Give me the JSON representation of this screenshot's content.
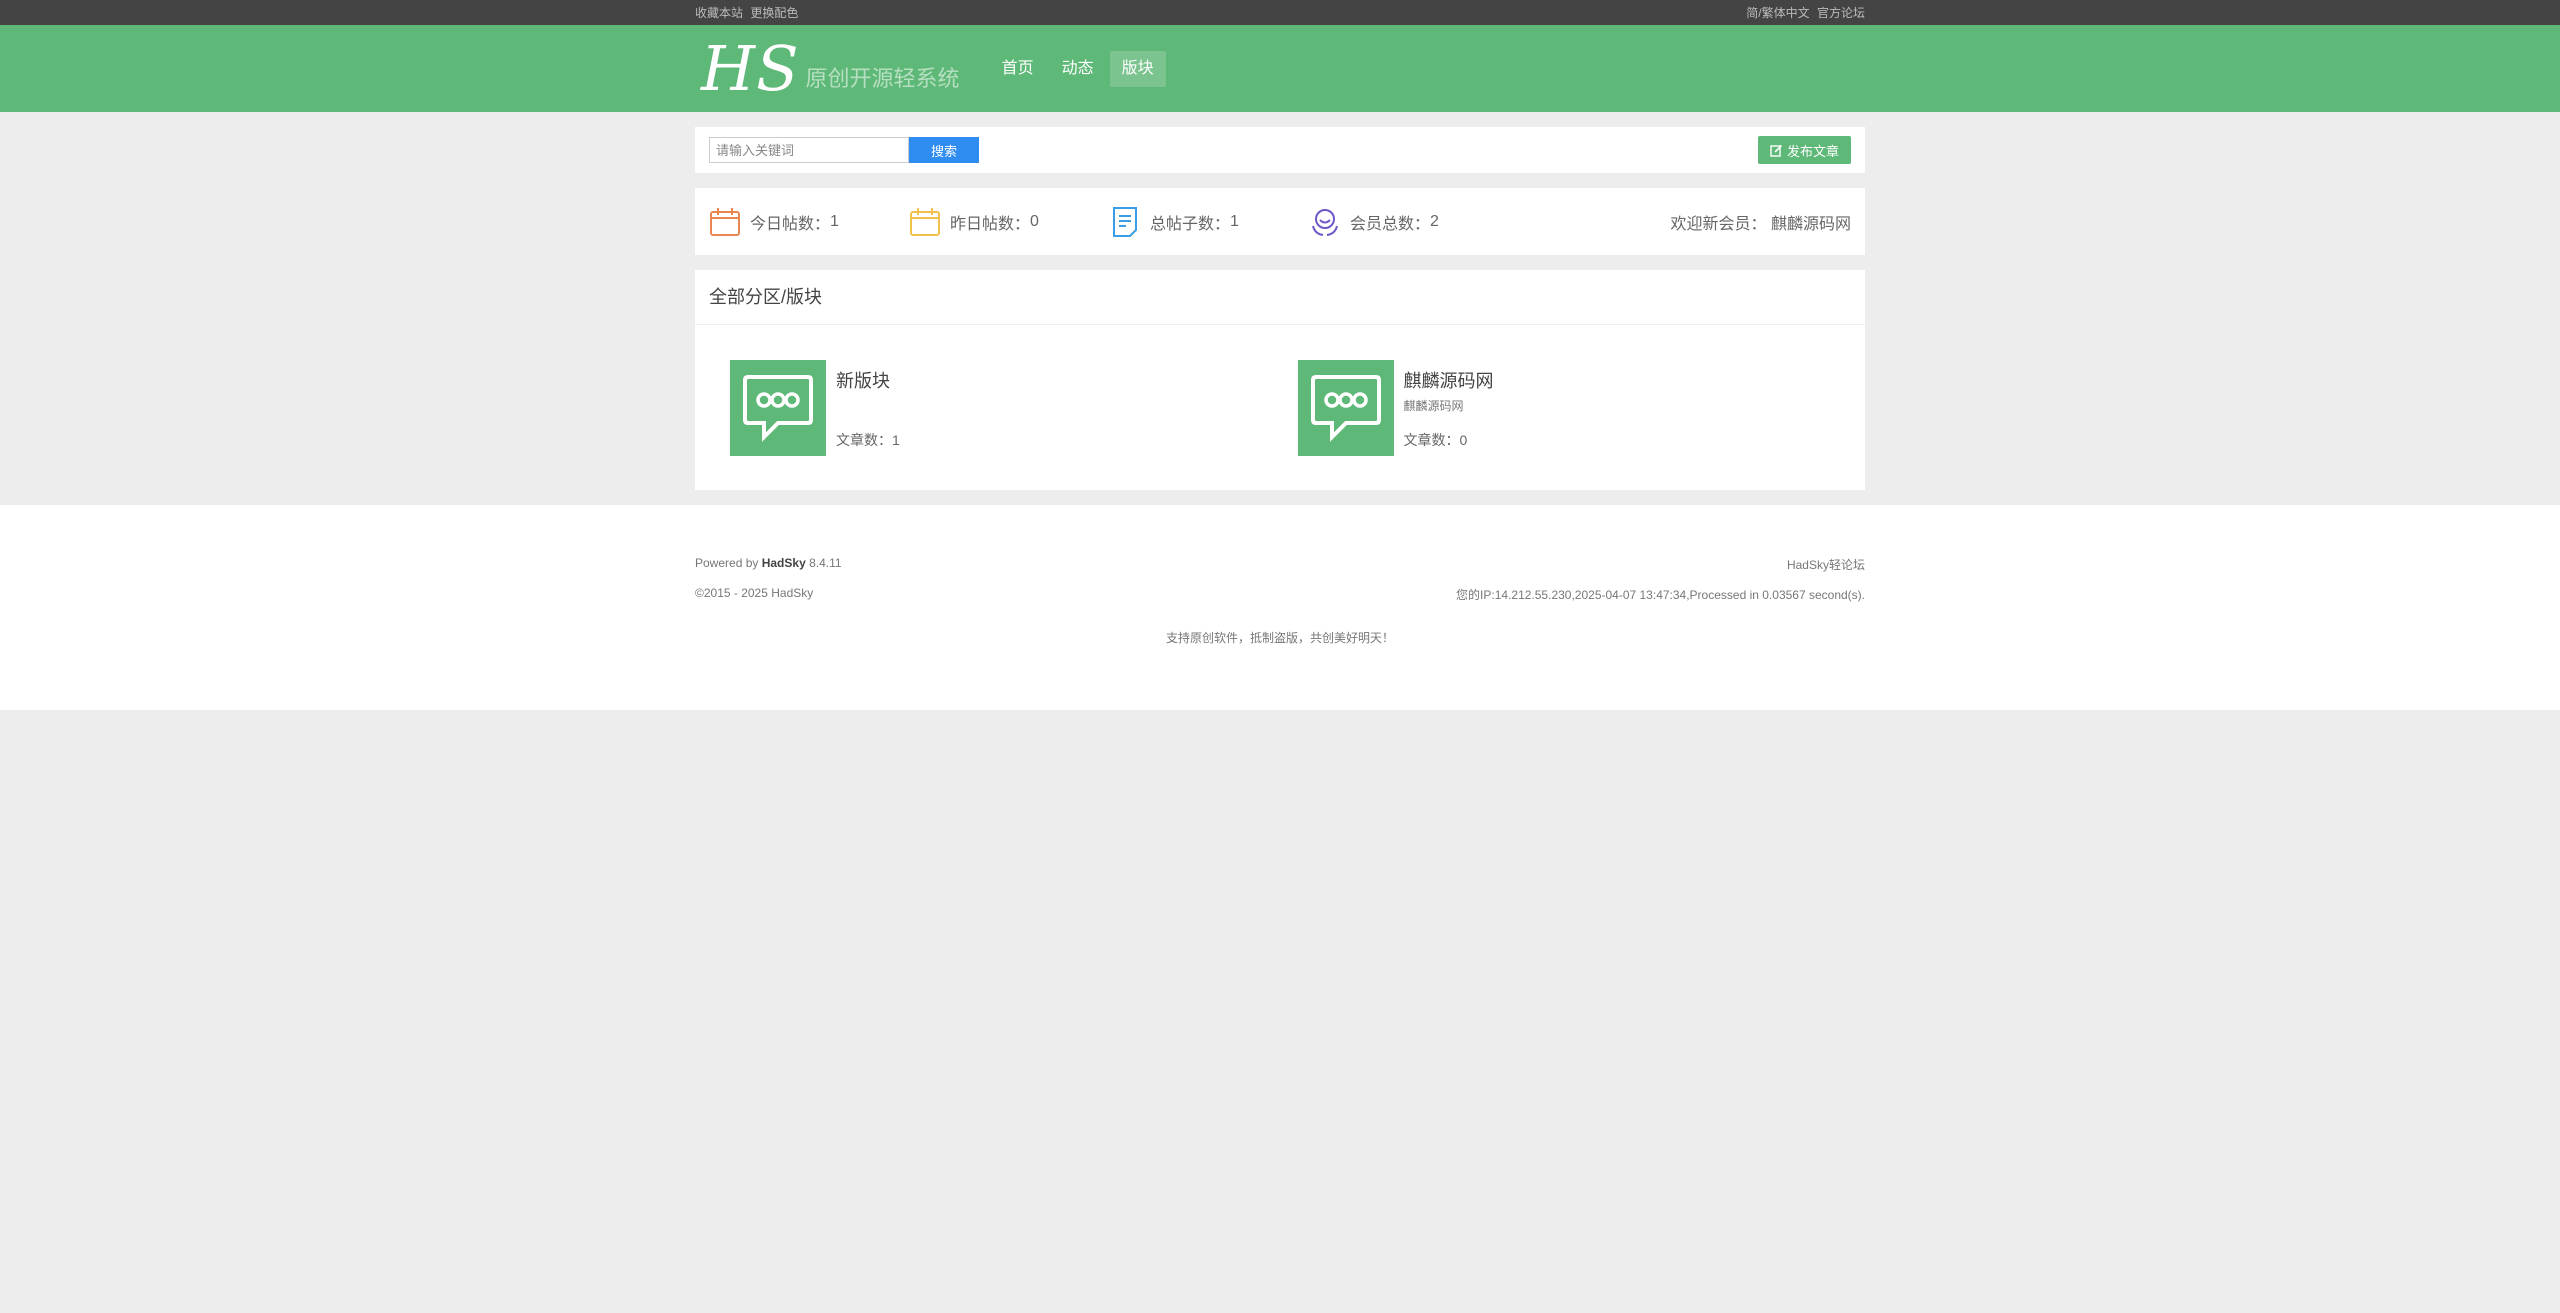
{
  "topbar": {
    "left": [
      "收藏本站",
      "更换配色"
    ],
    "right": [
      "简/繁体中文",
      "官方论坛"
    ]
  },
  "header": {
    "logo_main": "HS",
    "logo_sub": "原创开源轻系统",
    "nav": [
      {
        "label": "首页",
        "active": false
      },
      {
        "label": "动态",
        "active": false
      },
      {
        "label": "版块",
        "active": true
      }
    ]
  },
  "search": {
    "placeholder": "请输入关键词",
    "button": "搜索",
    "post_button": "发布文章"
  },
  "stats": {
    "today_label": "今日帖数：",
    "today": "1",
    "yesterday_label": "昨日帖数：",
    "yesterday": "0",
    "total_label": "总帖子数：",
    "total": "1",
    "members_label": "会员总数：",
    "members": "2",
    "welcome_label": "欢迎新会员：",
    "welcome_user": "麒麟源码网"
  },
  "colors": {
    "today_icon": "#e8874f",
    "yesterday_icon": "#f0c14b",
    "total_icon": "#3a9ee6",
    "members_icon": "#6f56c9",
    "green": "#5eb877"
  },
  "boards": {
    "title": "全部分区/版块",
    "items": [
      {
        "name": "新版块",
        "desc": "",
        "count_label": "文章数：",
        "count": "1"
      },
      {
        "name": "麒麟源码网",
        "desc": "麒麟源码网",
        "count_label": "文章数：",
        "count": "0"
      }
    ]
  },
  "footer": {
    "powered_prefix": "Powered by",
    "powered_name": "HadSky",
    "version": "8.4.11",
    "right1": "HadSky轻论坛",
    "copyright": "©2015 - 2025 HadSky",
    "right2": "您的IP:14.212.55.230,2025-04-07 13:47:34,Processed in 0.03567 second(s).",
    "slogan": "支持原创软件，抵制盗版，共创美好明天！"
  }
}
